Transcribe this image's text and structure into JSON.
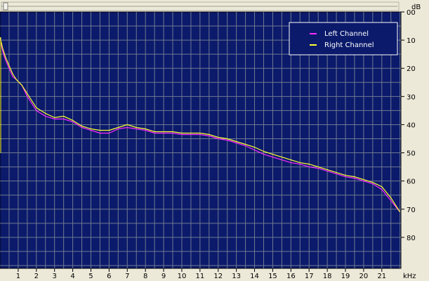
{
  "chart_data": {
    "type": "line",
    "title": "",
    "xlabel": "kHz",
    "ylabel": "dB",
    "xlim": [
      0,
      22.05
    ],
    "ylim": [
      0,
      91
    ],
    "y_inverted": true,
    "grid": true,
    "x_ticks": [
      "1",
      "2",
      "3",
      "4",
      "5",
      "6",
      "7",
      "8",
      "9",
      "10",
      "11",
      "12",
      "13",
      "14",
      "15",
      "16",
      "17",
      "18",
      "19",
      "20",
      "21"
    ],
    "y_ticks": [
      "00",
      "10",
      "20",
      "30",
      "40",
      "50",
      "60",
      "70",
      "80"
    ],
    "legend_position": "top-right",
    "background": "#0b1a6b",
    "grid_color": "#6f7a90",
    "series": [
      {
        "name": "Left Channel",
        "color": "#ff2cff",
        "points": [
          [
            0,
            9
          ],
          [
            0.15,
            14
          ],
          [
            0.3,
            17
          ],
          [
            0.5,
            20
          ],
          [
            0.7,
            23
          ],
          [
            0.9,
            24
          ],
          [
            1.2,
            26
          ],
          [
            1.5,
            30
          ],
          [
            1.8,
            33
          ],
          [
            2.0,
            35
          ],
          [
            2.5,
            37
          ],
          [
            3.0,
            38
          ],
          [
            3.5,
            38
          ],
          [
            4.0,
            39
          ],
          [
            4.5,
            41
          ],
          [
            5.0,
            42
          ],
          [
            5.5,
            43
          ],
          [
            6.0,
            43
          ],
          [
            6.5,
            41.5
          ],
          [
            7.0,
            41
          ],
          [
            7.5,
            41.5
          ],
          [
            8.0,
            42
          ],
          [
            8.5,
            43
          ],
          [
            9.0,
            43
          ],
          [
            9.5,
            43
          ],
          [
            10.0,
            43.5
          ],
          [
            10.5,
            43.5
          ],
          [
            11.0,
            43.5
          ],
          [
            11.5,
            44
          ],
          [
            12.0,
            45
          ],
          [
            12.5,
            45.5
          ],
          [
            13.0,
            46.5
          ],
          [
            13.5,
            47.5
          ],
          [
            14.0,
            49
          ],
          [
            14.5,
            50.5
          ],
          [
            15.0,
            51.5
          ],
          [
            15.5,
            52.5
          ],
          [
            16.0,
            53.5
          ],
          [
            16.5,
            54
          ],
          [
            17.0,
            55
          ],
          [
            17.5,
            55.5
          ],
          [
            18.0,
            56.5
          ],
          [
            18.5,
            57.5
          ],
          [
            19.0,
            58.5
          ],
          [
            19.5,
            59
          ],
          [
            20.0,
            60
          ],
          [
            20.5,
            61
          ],
          [
            21.0,
            63
          ],
          [
            21.5,
            67
          ],
          [
            22.0,
            71
          ]
        ]
      },
      {
        "name": "Right Channel",
        "color": "#ffff33",
        "points": [
          [
            0,
            9
          ],
          [
            0.15,
            13
          ],
          [
            0.3,
            16
          ],
          [
            0.5,
            19
          ],
          [
            0.7,
            22
          ],
          [
            0.9,
            24
          ],
          [
            1.2,
            26
          ],
          [
            1.5,
            29
          ],
          [
            1.8,
            32
          ],
          [
            2.0,
            34
          ],
          [
            2.5,
            36
          ],
          [
            3.0,
            37.5
          ],
          [
            3.5,
            37
          ],
          [
            4.0,
            38.5
          ],
          [
            4.5,
            40.5
          ],
          [
            5.0,
            41.5
          ],
          [
            5.5,
            42
          ],
          [
            6.0,
            42
          ],
          [
            6.5,
            41
          ],
          [
            7.0,
            40
          ],
          [
            7.5,
            41
          ],
          [
            8.0,
            41.5
          ],
          [
            8.5,
            42.5
          ],
          [
            9.0,
            42.5
          ],
          [
            9.5,
            42.5
          ],
          [
            10.0,
            43
          ],
          [
            10.5,
            43
          ],
          [
            11.0,
            43
          ],
          [
            11.5,
            43.5
          ],
          [
            12.0,
            44.5
          ],
          [
            12.5,
            45
          ],
          [
            13.0,
            46
          ],
          [
            13.5,
            47
          ],
          [
            14.0,
            48
          ],
          [
            14.5,
            49.5
          ],
          [
            15.0,
            50.5
          ],
          [
            15.5,
            51.5
          ],
          [
            16.0,
            52.5
          ],
          [
            16.5,
            53.5
          ],
          [
            17.0,
            54
          ],
          [
            17.5,
            55
          ],
          [
            18.0,
            56
          ],
          [
            18.5,
            57
          ],
          [
            19.0,
            58
          ],
          [
            19.5,
            58.5
          ],
          [
            20.0,
            59.5
          ],
          [
            20.5,
            60.5
          ],
          [
            21.0,
            62
          ],
          [
            21.5,
            66
          ],
          [
            22.0,
            71
          ]
        ]
      }
    ]
  }
}
